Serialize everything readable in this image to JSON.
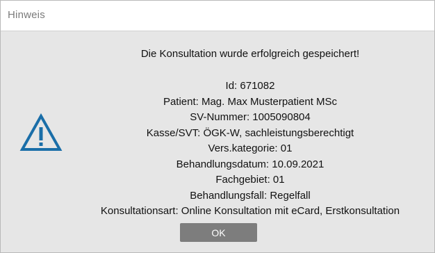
{
  "window": {
    "title": "Hinweis"
  },
  "icon": {
    "name": "warning-triangle-icon",
    "color": "#1a6ea8"
  },
  "message": {
    "headline": "Die Konsultation wurde erfolgreich gespeichert!",
    "details": [
      "Id: 671082",
      "Patient: Mag. Max Musterpatient MSc",
      "SV-Nummer: 1005090804",
      "Kasse/SVT: ÖGK-W, sachleistungsberechtigt",
      "Vers.kategorie: 01",
      "Behandlungsdatum: 10.09.2021",
      "Fachgebiet: 01",
      "Behandlungsfall: Regelfall",
      "Konsultationsart: Online Konsultation mit eCard, Erstkonsultation"
    ]
  },
  "buttons": {
    "ok_label": "OK"
  },
  "colors": {
    "dialog_background": "#e6e6e6",
    "titlebar_background": "#ffffff",
    "button_background": "#7d7d7d"
  }
}
